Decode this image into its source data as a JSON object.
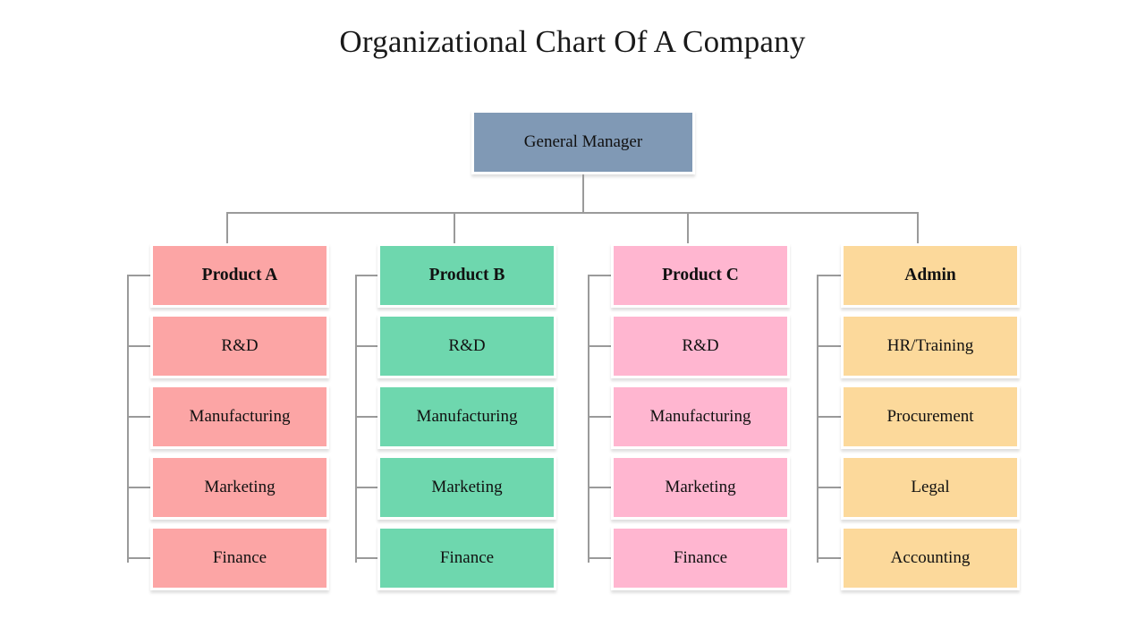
{
  "title": "Organizational Chart Of A Company",
  "root": {
    "label": "General Manager",
    "color": "#8099b5"
  },
  "connector_color": "#9a9a9a",
  "background": "#ffffff",
  "columns": [
    {
      "header": "Product A",
      "color": "#fca5a5",
      "items": [
        "R&D",
        "Manufacturing",
        "Marketing",
        "Finance"
      ]
    },
    {
      "header": "Product B",
      "color": "#6ed7ae",
      "items": [
        "R&D",
        "Manufacturing",
        "Marketing",
        "Finance"
      ]
    },
    {
      "header": "Product C",
      "color": "#ffb6d0",
      "items": [
        "R&D",
        "Manufacturing",
        "Marketing",
        "Finance"
      ]
    },
    {
      "header": "Admin",
      "color": "#fcd99b",
      "items": [
        "HR/Training",
        "Procurement",
        "Legal",
        "Accounting"
      ]
    }
  ],
  "chart_data": {
    "type": "diagram",
    "diagram_type": "organizational-chart",
    "title": "Organizational Chart Of A Company",
    "levels": 2,
    "nodes": [
      {
        "id": "gm",
        "label": "General Manager",
        "level": 0,
        "parent": null,
        "color": "#8099b5"
      },
      {
        "id": "pa",
        "label": "Product A",
        "level": 1,
        "parent": "gm",
        "color": "#fca5a5"
      },
      {
        "id": "pb",
        "label": "Product B",
        "level": 1,
        "parent": "gm",
        "color": "#6ed7ae"
      },
      {
        "id": "pc",
        "label": "Product C",
        "level": 1,
        "parent": "gm",
        "color": "#ffb6d0"
      },
      {
        "id": "ad",
        "label": "Admin",
        "level": 1,
        "parent": "gm",
        "color": "#fcd99b"
      },
      {
        "id": "pa1",
        "label": "R&D",
        "level": 2,
        "parent": "pa",
        "color": "#fca5a5"
      },
      {
        "id": "pa2",
        "label": "Manufacturing",
        "level": 2,
        "parent": "pa",
        "color": "#fca5a5"
      },
      {
        "id": "pa3",
        "label": "Marketing",
        "level": 2,
        "parent": "pa",
        "color": "#fca5a5"
      },
      {
        "id": "pa4",
        "label": "Finance",
        "level": 2,
        "parent": "pa",
        "color": "#fca5a5"
      },
      {
        "id": "pb1",
        "label": "R&D",
        "level": 2,
        "parent": "pb",
        "color": "#6ed7ae"
      },
      {
        "id": "pb2",
        "label": "Manufacturing",
        "level": 2,
        "parent": "pb",
        "color": "#6ed7ae"
      },
      {
        "id": "pb3",
        "label": "Marketing",
        "level": 2,
        "parent": "pb",
        "color": "#6ed7ae"
      },
      {
        "id": "pb4",
        "label": "Finance",
        "level": 2,
        "parent": "pb",
        "color": "#6ed7ae"
      },
      {
        "id": "pc1",
        "label": "R&D",
        "level": 2,
        "parent": "pc",
        "color": "#ffb6d0"
      },
      {
        "id": "pc2",
        "label": "Manufacturing",
        "level": 2,
        "parent": "pc",
        "color": "#ffb6d0"
      },
      {
        "id": "pc3",
        "label": "Marketing",
        "level": 2,
        "parent": "pc",
        "color": "#ffb6d0"
      },
      {
        "id": "pc4",
        "label": "Finance",
        "level": 2,
        "parent": "pc",
        "color": "#ffb6d0"
      },
      {
        "id": "ad1",
        "label": "HR/Training",
        "level": 2,
        "parent": "ad",
        "color": "#fcd99b"
      },
      {
        "id": "ad2",
        "label": "Procurement",
        "level": 2,
        "parent": "ad",
        "color": "#fcd99b"
      },
      {
        "id": "ad3",
        "label": "Legal",
        "level": 2,
        "parent": "ad",
        "color": "#fcd99b"
      },
      {
        "id": "ad4",
        "label": "Accounting",
        "level": 2,
        "parent": "ad",
        "color": "#fcd99b"
      }
    ]
  }
}
